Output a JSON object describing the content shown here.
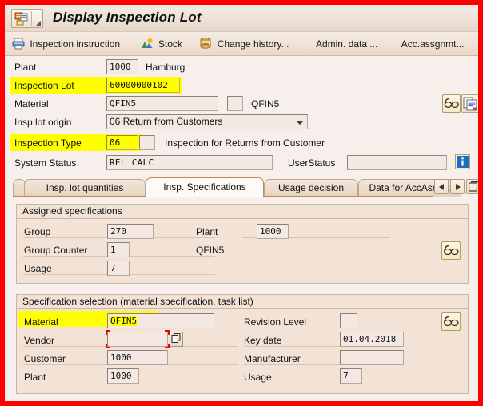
{
  "window": {
    "title": "Display Inspection Lot",
    "title_icon": "inspection-lot-icon",
    "border_color": "#ff0000"
  },
  "toolbar": {
    "buttons": [
      {
        "label": "Inspection instruction",
        "icon": "printer-icon"
      },
      {
        "label": "Stock",
        "icon": "stock-chart-icon"
      },
      {
        "label": "Change history...",
        "icon": "scroll-history-icon"
      },
      {
        "label": "Admin. data ...",
        "icon": "none"
      },
      {
        "label": "Acc.assgnmt...",
        "icon": "none"
      },
      {
        "label": "",
        "icon": "stock-chart-icon"
      }
    ]
  },
  "header_form": {
    "plant": {
      "label": "Plant",
      "value": "1000",
      "description": "Hamburg"
    },
    "inspection_lot": {
      "label": "Inspection Lot",
      "value": "60000000102",
      "highlight": true
    },
    "material": {
      "label": "Material",
      "value": "QFIN5",
      "description": "QFIN5"
    },
    "insp_lot_origin": {
      "label": "Insp.lot origin",
      "value": "06 Return from Customers"
    },
    "inspection_type": {
      "label": "Inspection Type",
      "value": "06",
      "description": "Inspection for Returns from Customer",
      "highlight": true
    },
    "system_status": {
      "label": "System Status",
      "value": "REL   CALC"
    },
    "user_status": {
      "label": "UserStatus",
      "value": ""
    },
    "icons": {
      "glasses": "glasses-icon",
      "copy": "copy-document-icon",
      "info": "info-icon"
    }
  },
  "tabs": [
    {
      "label": "Insp. lot quantities",
      "active": false
    },
    {
      "label": "Insp. Specifications",
      "active": true
    },
    {
      "label": "Usage decision",
      "active": false
    },
    {
      "label": "Data for AccAssg...",
      "active": false
    }
  ],
  "tab_nav": {
    "prev": "scroll-left-icon",
    "next": "scroll-right-icon",
    "list": "tab-list-icon"
  },
  "assigned_specifications": {
    "title": "Assigned specifications",
    "group": {
      "label": "Group",
      "value": "270"
    },
    "plant": {
      "label": "Plant",
      "value": "1000"
    },
    "group_counter": {
      "label": "Group Counter",
      "value": "1"
    },
    "group_counter_desc": "QFIN5",
    "usage": {
      "label": "Usage",
      "value": "7"
    },
    "detail_icon": "glasses-icon"
  },
  "specification_selection": {
    "title": "Specification selection (material specification, task list)",
    "material": {
      "label": "Material",
      "value": "QFIN5",
      "highlight": true
    },
    "revision_level": {
      "label": "Revision Level",
      "value": ""
    },
    "vendor": {
      "label": "Vendor",
      "value": "",
      "focused": true,
      "matchcode_icon": "matchcode-icon"
    },
    "key_date": {
      "label": "Key date",
      "value": "01.04.2018"
    },
    "customer": {
      "label": "Customer",
      "value": "1000"
    },
    "manufacturer": {
      "label": "Manufacturer",
      "value": ""
    },
    "plant": {
      "label": "Plant",
      "value": "1000"
    },
    "usage": {
      "label": "Usage",
      "value": "7"
    },
    "detail_icon": "glasses-icon"
  },
  "colors": {
    "highlight": "#ffff00",
    "panel": "#f3e2d6",
    "form_bg": "#f7efec",
    "field_bg": "#f4e8e2",
    "accent": "#c08a4a"
  }
}
